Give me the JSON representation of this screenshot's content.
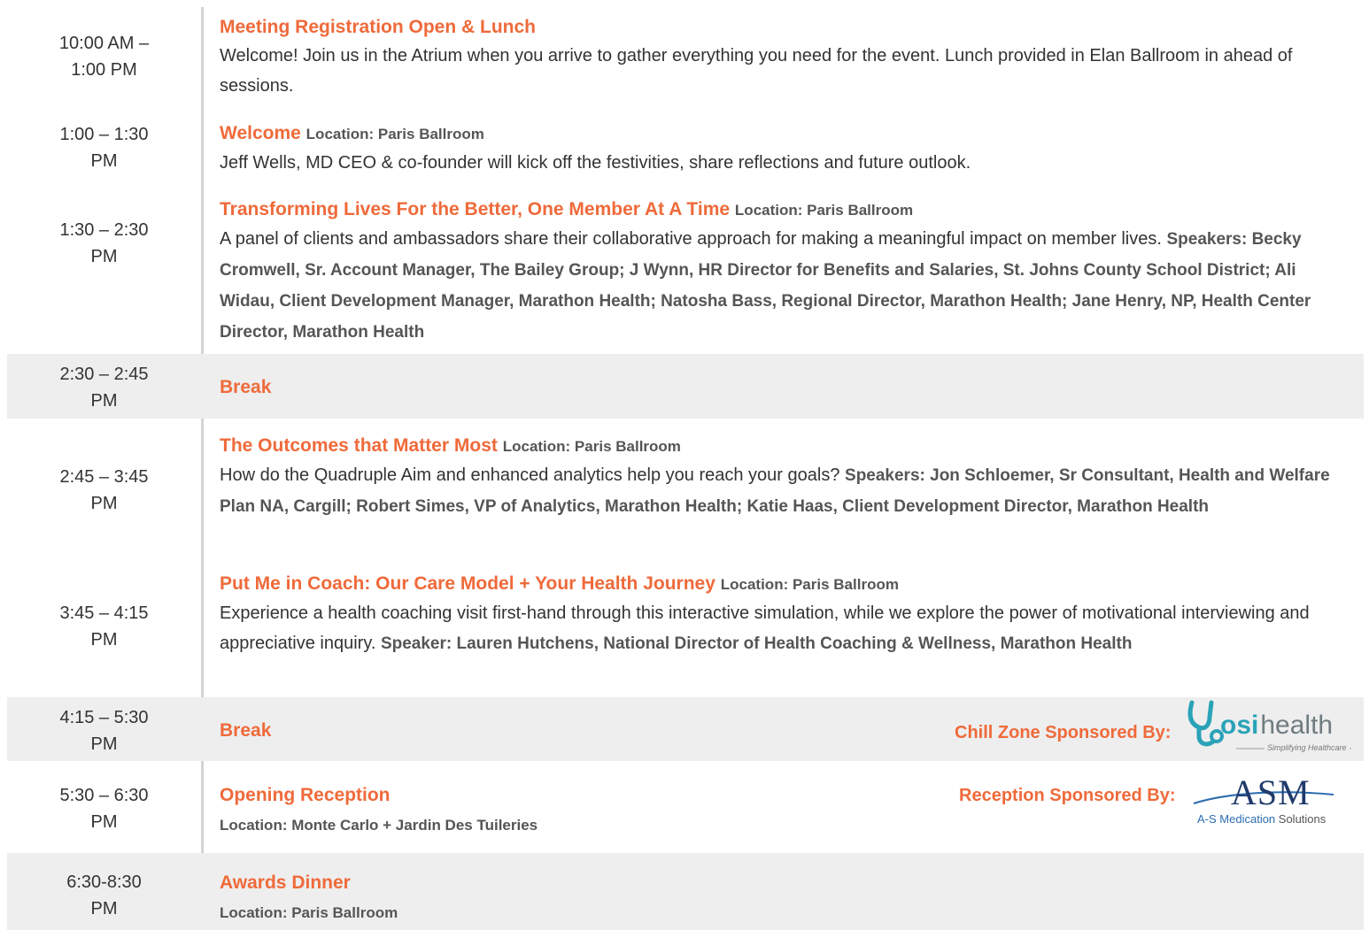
{
  "colors": {
    "accent": "#ef6a3a",
    "shade": "#eeeeee",
    "text": "#333333"
  },
  "rows": [
    {
      "time_a": "10:00 AM –",
      "time_b": "1:00 PM",
      "title": "Meeting Registration Open & Lunch",
      "desc": "Welcome! Join us in the Atrium when you arrive to gather everything you need for the event. Lunch provided in Elan Ballroom in  ahead of sessions."
    },
    {
      "time_a": "1:00 – 1:30",
      "time_b": "PM",
      "title": "Welcome",
      "location": "Location: Paris Ballroom",
      "desc": "Jeff Wells, MD CEO & co-founder will kick off the festivities, share reflections and future outlook."
    },
    {
      "time_a": "1:30 – 2:30",
      "time_b": "PM",
      "title": "Transforming  Lives For the Better, One Member At A Time",
      "location": "Location: Paris Ballroom",
      "desc": "A panel of clients and ambassadors share their collaborative approach for making a meaningful impact on member lives.",
      "speakers": "Speakers:  Becky Cromwell, Sr. Account Manager, The Bailey Group; J Wynn, HR Director for Benefits and Salaries,  St. Johns County School District; Ali Widau, Client Development Manager, Marathon Health; Natosha Bass, Regional Director,  Marathon Health; Jane Henry, NP, Health Center Director, Marathon Health"
    },
    {
      "time_a": "2:30 – 2:45",
      "time_b": "PM",
      "title": "Break"
    },
    {
      "time_a": "2:45 – 3:45",
      "time_b": "PM",
      "title": "The Outcomes that Matter Most",
      "location": "Location: Paris Ballroom",
      "desc": "How do the Quadruple Aim and enhanced analytics help you reach your goals?",
      "speakers": "Speakers:  Jon Schloemer,  Sr Consultant, Health  and Welfare Plan NA, Cargill; Robert Simes,  VP of Analytics, Marathon Health; Katie Haas,  Client Development Director, Marathon Health"
    },
    {
      "time_a": "3:45 – 4:15",
      "time_b": "PM",
      "title": "Put Me in Coach: Our Care Model + Your Health  Journey",
      "location": "Location: Paris Ballroom",
      "desc": "Experience a health coaching visit first-hand through this interactive simulation, while we explore the power of motivational interviewing and appreciative inquiry.",
      "speakers": "Speaker:   Lauren Hutchens, National Director of Health  Coaching & Wellness,  Marathon Health"
    },
    {
      "time_a": "4:15  – 5:30",
      "time_b": "PM",
      "title": "Break",
      "sponsor_label": "Chill Zone Sponsored By:",
      "logo_main_a": "Y",
      "logo_main_b": "osi",
      "logo_main_c": "health",
      "logo_tag": "Simplifying Healthcare"
    },
    {
      "time_a": "5:30  – 6:30",
      "time_b": "PM",
      "title": "Opening Reception",
      "location": "Location: Monte Carlo + Jardin Des Tuileries",
      "sponsor_label": "Reception  Sponsored By:",
      "logo_main": "ASM",
      "logo_tag_a": "A-S ",
      "logo_tag_b": "Medication",
      "logo_tag_c": " Solutions"
    },
    {
      "time_a": "6:30-8:30",
      "time_b": "PM",
      "title": "Awards Dinner",
      "location": "Location: Paris Ballroom"
    }
  ]
}
